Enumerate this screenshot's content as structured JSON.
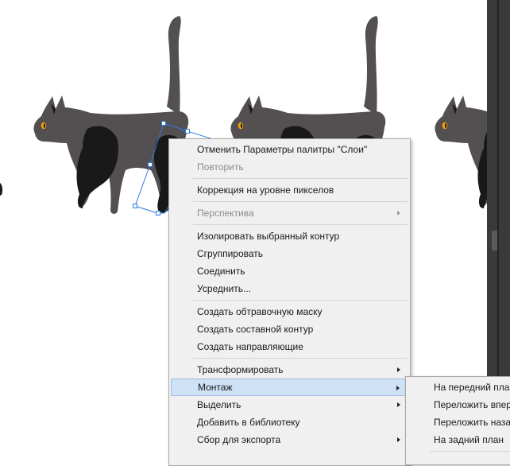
{
  "colors": {
    "cat_body": "#545051",
    "cat_shadow": "#191919",
    "cat_eye": "#f2a30c",
    "selection": "#2f7be0",
    "menu_bg": "#f0f0f0",
    "menu_highlight": "#cfe1f5",
    "scrollbar": "#3a3a3a"
  },
  "context_menu": {
    "items": [
      {
        "label": "Отменить Параметры палитры \"Слои\"",
        "enabled": true
      },
      {
        "label": "Повторить",
        "enabled": false
      },
      {
        "label": "Коррекция на уровне пикселов",
        "enabled": true
      },
      {
        "label": "Перспектива",
        "enabled": false,
        "submenu": true
      },
      {
        "label": "Изолировать выбранный контур",
        "enabled": true
      },
      {
        "label": "Сгруппировать",
        "enabled": true
      },
      {
        "label": "Соединить",
        "enabled": true
      },
      {
        "label": "Усреднить...",
        "enabled": true
      },
      {
        "label": "Создать обтравочную маску",
        "enabled": true
      },
      {
        "label": "Создать составной контур",
        "enabled": true
      },
      {
        "label": "Создать направляющие",
        "enabled": true
      },
      {
        "label": "Трансформировать",
        "enabled": true,
        "submenu": true
      },
      {
        "label": "Монтаж",
        "enabled": true,
        "submenu": true,
        "highlighted": true
      },
      {
        "label": "Выделить",
        "enabled": true,
        "submenu": true
      },
      {
        "label": "Добавить в библиотеку",
        "enabled": true
      },
      {
        "label": "Сбор для экспорта",
        "enabled": true,
        "submenu": true
      }
    ]
  },
  "submenu": {
    "items": [
      {
        "label": "На передний план"
      },
      {
        "label": "Переложить вперед"
      },
      {
        "label": "Переложить назад"
      },
      {
        "label": "На задний план"
      }
    ]
  }
}
